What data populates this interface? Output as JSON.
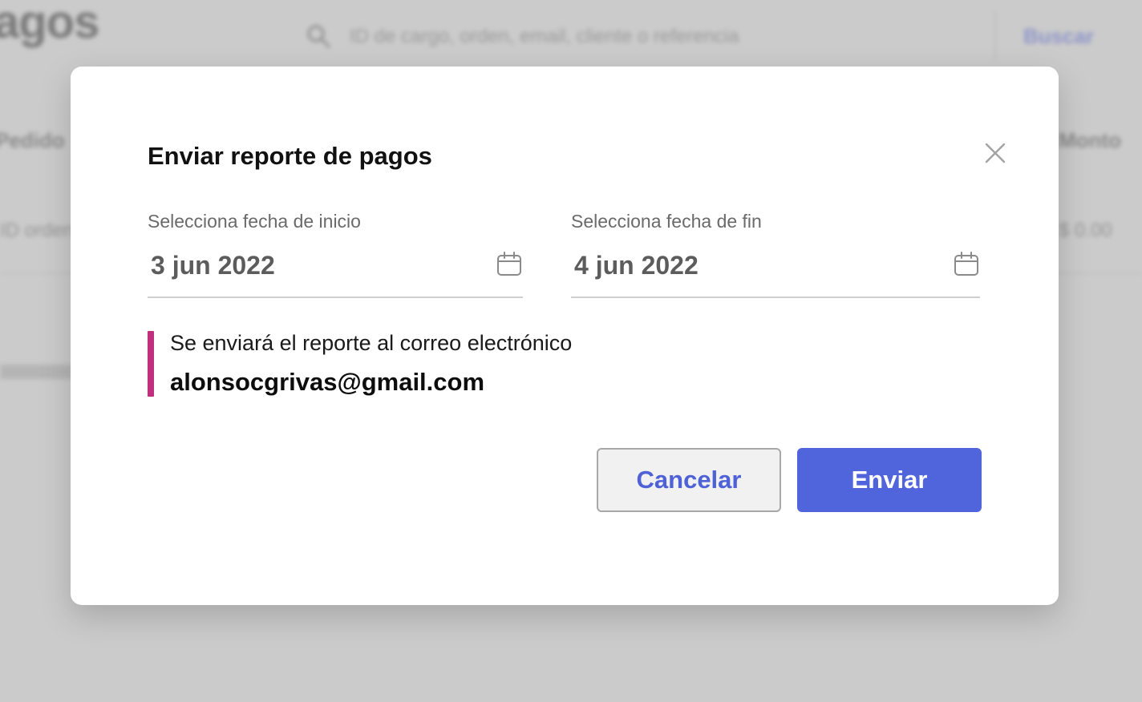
{
  "background": {
    "logo_text": "agos",
    "search_placeholder": "ID de cargo, orden, email, cliente o referencia",
    "search_button_label": "Buscar",
    "column_left_text": "Pedido",
    "column_right_text": "Monto",
    "row_left_text": "ID orden",
    "row_right_text": "$ 0.00"
  },
  "modal": {
    "title": "Enviar reporte de pagos",
    "close_icon": "close-icon",
    "start_date": {
      "label": "Selecciona fecha de inicio",
      "value": "3 jun 2022",
      "icon": "calendar-icon"
    },
    "end_date": {
      "label": "Selecciona fecha de fin",
      "value": "4 jun 2022",
      "icon": "calendar-icon"
    },
    "info": {
      "message": "Se enviará el reporte al correo electrónico",
      "email": "alonsocgrivas@gmail.com",
      "accent_color": "#c0307f"
    },
    "buttons": {
      "cancel_label": "Cancelar",
      "send_label": "Enviar"
    }
  },
  "colors": {
    "primary": "#5064dc",
    "overlay": "#cbcbcb"
  }
}
